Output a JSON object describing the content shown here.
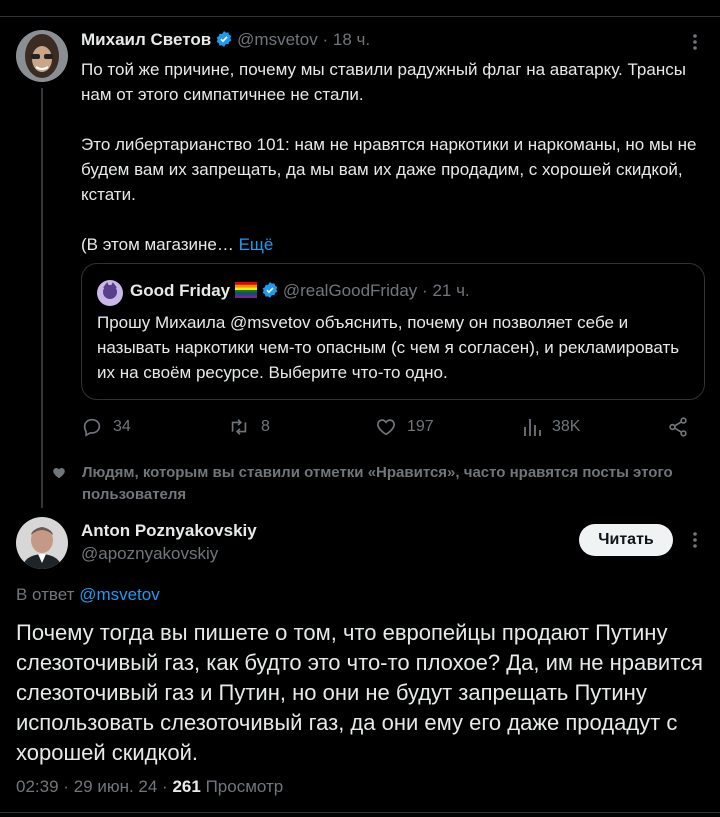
{
  "tweet": {
    "author_name": "Михаил Светов",
    "handle": "@msvetov",
    "time": "18 ч.",
    "separator": "·",
    "para1": "По той же причине, почему мы ставили радужный флаг на аватарку. Трансы нам от этого симпатичнее не стали.",
    "para2": "Это либертарианство 101: нам не нравятся наркотики и наркоманы, но мы не будем вам их запрещать, да мы вам их даже продадим, с хорошей скидкой, кстати.",
    "para3": "(В этом магазине…",
    "more_link": "Ещё",
    "more_icon": "vertical-dots-icon",
    "quote": {
      "author_name": "Good Friday",
      "handle": "@realGoodFriday",
      "time": "21 ч.",
      "text": "Прошу Михаила @msvetov объяснить, почему он позволяет себе и называть наркотики чем-то опасным (с чем я согласен), и рекламировать их на своём ресурсе. Выберите что-то одно."
    },
    "actions": {
      "replies": "34",
      "reposts": "8",
      "likes": "197",
      "views": "38K"
    }
  },
  "recommendation": {
    "text": "Людям, которым вы ставили отметки «Нравится», часто нравятся посты этого пользователя"
  },
  "main_tweet": {
    "author_name": "Anton Poznyakovskiy",
    "handle": "@apoznyakovskiy",
    "follow_label": "Читать",
    "reply_prefix": "В ответ",
    "reply_to": "@msvetov",
    "text": "Почему тогда вы пишете о том, что европейцы продают Путину слезоточивый газ, как будто это что-то плохое? Да, им не нравится слезоточивый газ и Путин, но они не будут запрещать Путину использовать слезоточивый газ, да они ему его даже продадут с хорошей скидкой.",
    "time": "02:39",
    "date": "29 июн. 24",
    "views_count": "261",
    "views_label": "Просмотр"
  },
  "colors": {
    "background": "#000000",
    "text": "#e7e9ea",
    "muted": "#71767b",
    "link": "#1d9bf0",
    "border": "#2f3336",
    "button_bg": "#eff3f4"
  }
}
